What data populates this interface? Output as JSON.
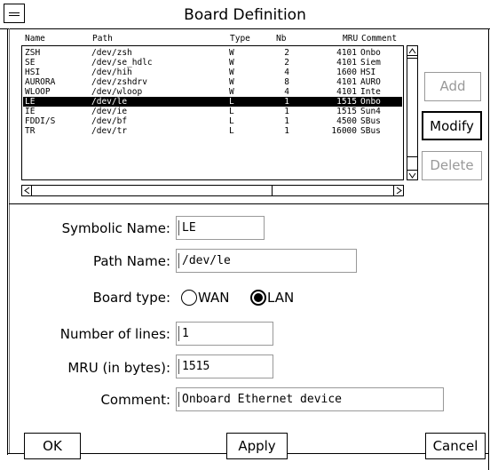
{
  "window": {
    "title": "Board Definition"
  },
  "list": {
    "headers": {
      "name": "Name",
      "path": "Path",
      "type": "Type",
      "nb": "Nb",
      "mru": "MRU",
      "comment": "Comment"
    },
    "rows": [
      {
        "name": "ZSH",
        "path": "/dev/zsh",
        "type": "W",
        "nb": "2",
        "mru": "4101",
        "comment": "Onbo",
        "selected": false
      },
      {
        "name": "SE",
        "path": "/dev/se_hdlc",
        "type": "W",
        "nb": "2",
        "mru": "4101",
        "comment": "Siem",
        "selected": false
      },
      {
        "name": "HSI",
        "path": "/dev/hih",
        "type": "W",
        "nb": "4",
        "mru": "1600",
        "comment": "HSI",
        "selected": false
      },
      {
        "name": "AURORA",
        "path": "/dev/zshdrv",
        "type": "W",
        "nb": "8",
        "mru": "4101",
        "comment": "AURO",
        "selected": false
      },
      {
        "name": "WLOOP",
        "path": "/dev/wloop",
        "type": "W",
        "nb": "4",
        "mru": "4101",
        "comment": "Inte",
        "selected": false
      },
      {
        "name": "LE",
        "path": "/dev/le",
        "type": "L",
        "nb": "1",
        "mru": "1515",
        "comment": "Onbo",
        "selected": true
      },
      {
        "name": "IE",
        "path": "/dev/ie",
        "type": "L",
        "nb": "1",
        "mru": "1515",
        "comment": "Sun4",
        "selected": false
      },
      {
        "name": "FDDI/S",
        "path": "/dev/bf",
        "type": "L",
        "nb": "1",
        "mru": "4500",
        "comment": "SBus",
        "selected": false
      },
      {
        "name": "TR",
        "path": "/dev/tr",
        "type": "L",
        "nb": "1",
        "mru": "16000",
        "comment": "SBus",
        "selected": false
      }
    ]
  },
  "side_buttons": {
    "add": "Add",
    "modify": "Modify",
    "delete": "Delete"
  },
  "form": {
    "symbolic_name": {
      "label": "Symbolic Name:",
      "value": "LE"
    },
    "path_name": {
      "label": "Path Name:",
      "value": "/dev/le"
    },
    "board_type": {
      "label": "Board type:",
      "wan": "WAN",
      "lan": "LAN",
      "selected": "LAN"
    },
    "number_of_lines": {
      "label": "Number of lines:",
      "value": "1"
    },
    "mru": {
      "label": "MRU (in bytes):",
      "value": "1515"
    },
    "comment": {
      "label": "Comment:",
      "value": "Onboard Ethernet device"
    }
  },
  "buttons": {
    "ok": "OK",
    "apply": "Apply",
    "cancel": "Cancel"
  }
}
